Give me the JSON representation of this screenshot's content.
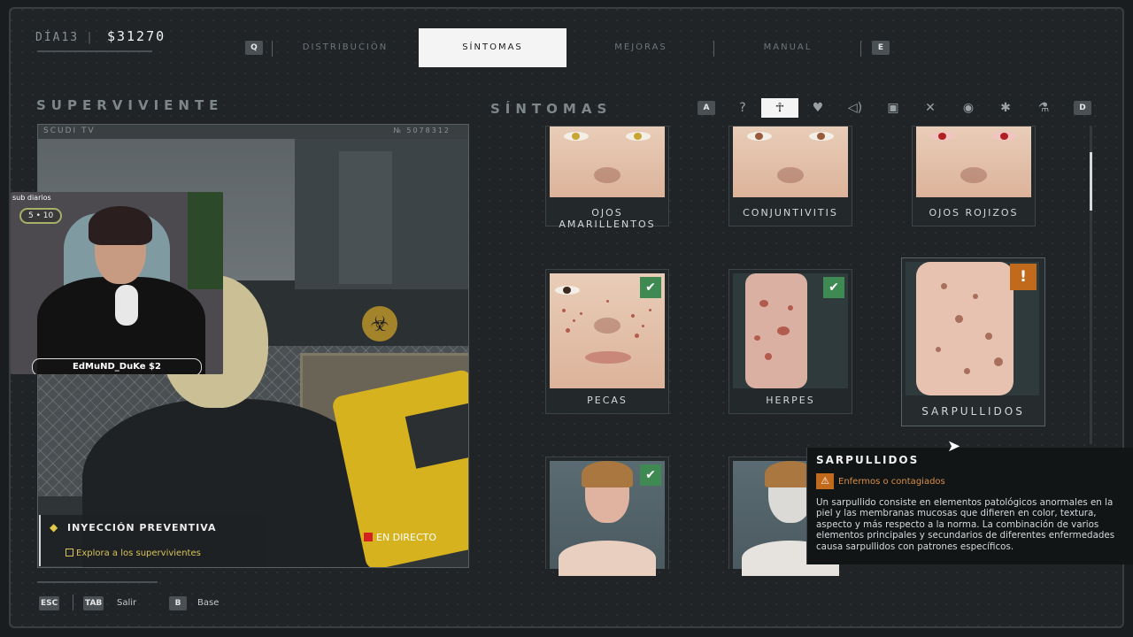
{
  "hud": {
    "day": "DÍA13",
    "money": "$31270"
  },
  "nav": {
    "key_left": "Q",
    "key_right": "E",
    "tabs": [
      {
        "label": "DISTRIBUCIÓN"
      },
      {
        "label": "SÍNTOMAS"
      },
      {
        "label": "MEJORAS"
      },
      {
        "label": "MANUAL"
      }
    ],
    "active_tab": "SÍNTOMAS"
  },
  "left_panel": {
    "title": "SUPERVIVIENTE",
    "camera_name": "SCUDI TV",
    "camera_id": "№ 5078312",
    "live_label": "EN DIRECTO"
  },
  "webcam_overlay": {
    "sub_label": "sub diarios",
    "sub_counter": "5 • 10",
    "donation": "EdMuND_DuKe $2"
  },
  "mission": {
    "title": "INYECCIÓN PREVENTIVA",
    "objective": "Explora a los supervivientes"
  },
  "right_panel": {
    "title": "SÍNTOMAS",
    "key_left": "A",
    "key_right": "D",
    "filters": [
      {
        "icon": "question-icon",
        "glyph": "?"
      },
      {
        "icon": "body-icon",
        "glyph": "☥"
      },
      {
        "icon": "heart-icon",
        "glyph": "♥"
      },
      {
        "icon": "sound-icon",
        "glyph": "◁)"
      },
      {
        "icon": "stomach-icon",
        "glyph": "▣"
      },
      {
        "icon": "tools-icon",
        "glyph": "✕"
      },
      {
        "icon": "eye-icon",
        "glyph": "◉"
      },
      {
        "icon": "brain-icon",
        "glyph": "✱"
      },
      {
        "icon": "flask-icon",
        "glyph": "⚗"
      }
    ],
    "active_filter": "body-icon",
    "cards": [
      {
        "label": "OJOS AMARILLENTOS",
        "eye_color": "#c9a534",
        "status": "none"
      },
      {
        "label": "CONJUNTIVITIS",
        "eye_color": "#9a5a3c",
        "status": "none"
      },
      {
        "label": "OJOS ROJIZOS",
        "eye_color": "#b02020",
        "status": "none"
      },
      {
        "label": "PECAS",
        "status": "check"
      },
      {
        "label": "HERPES",
        "status": "check"
      },
      {
        "label": "SARPULLIDOS",
        "status": "warning"
      },
      {
        "label": "",
        "status": "check"
      },
      {
        "label": "",
        "status": "none"
      }
    ]
  },
  "tooltip": {
    "title": "SARPULLIDOS",
    "tag": "Enfermos o contagiados",
    "description": "Un sarpullido consiste en elementos patológicos anormales en la piel y las membranas mucosas que difieren en color, textura, aspecto y más respecto a la norma. La combinación de varios elementos principales y secundarios de diferentes enfermedades causa sarpullidos con patrones específicos."
  },
  "footer": {
    "esc_key": "ESC",
    "tab_key": "TAB",
    "tab_label": "Salir",
    "b_key": "B",
    "b_label": "Base"
  },
  "colors": {
    "active_bg": "#f4f4f4",
    "check": "#3f8a52",
    "warning": "#c26a1c",
    "mission_accent": "#d9c45a",
    "live": "#d42020"
  }
}
